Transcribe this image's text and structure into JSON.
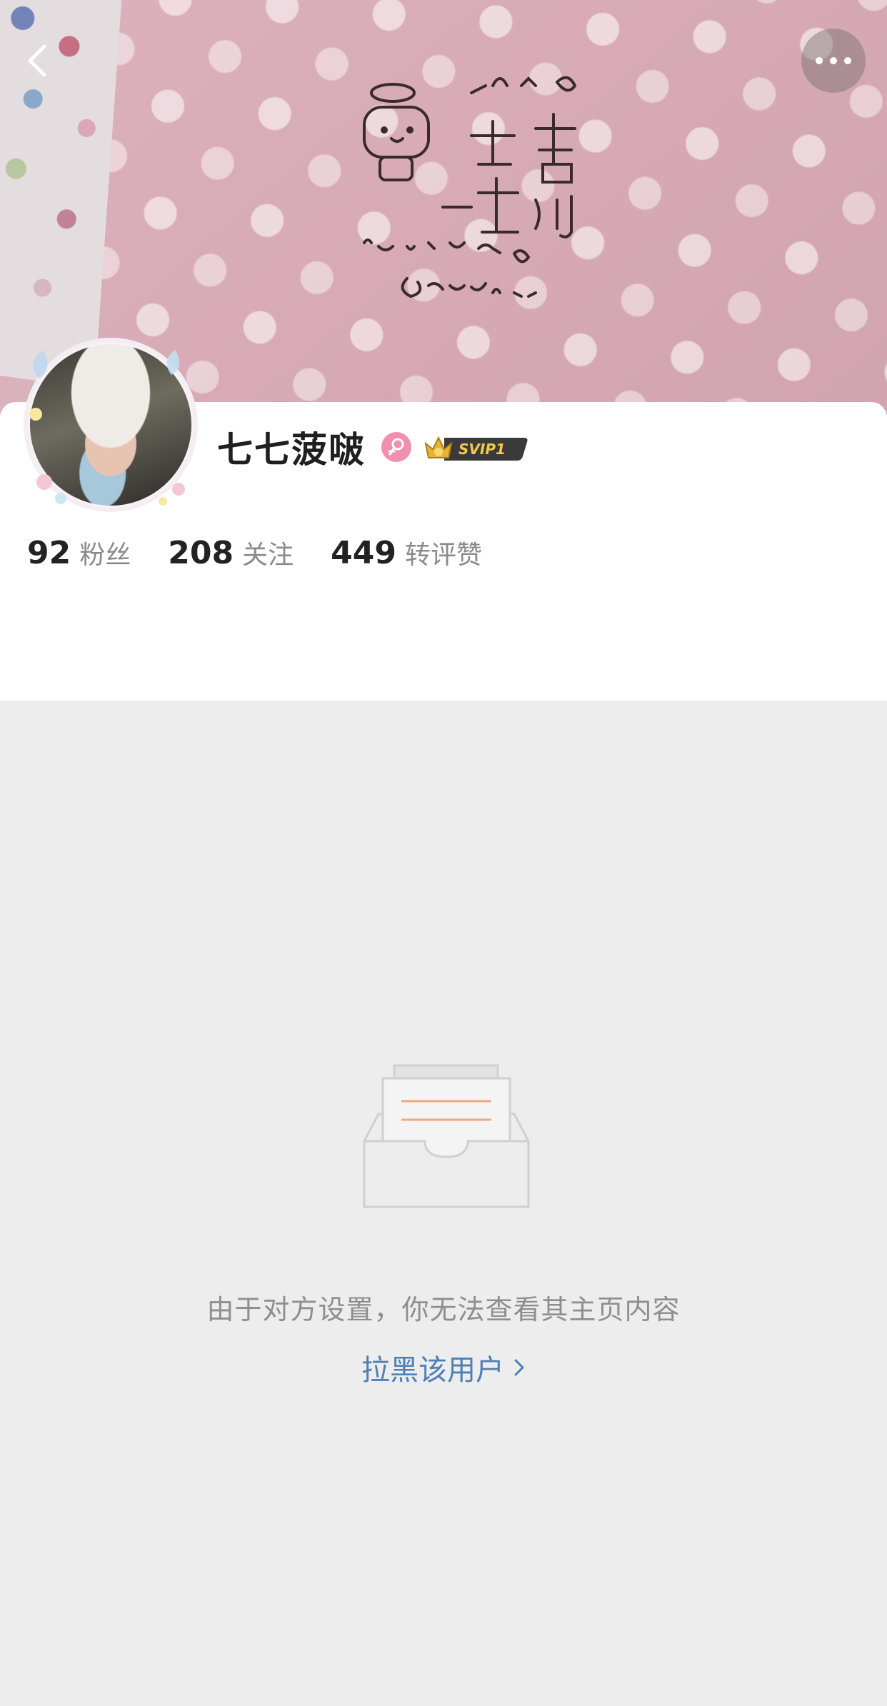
{
  "header": {
    "back_icon": "chevron-left-icon",
    "more_icon": "more-dots-icon"
  },
  "profile": {
    "name": "七七菠啵",
    "gender_icon": "female-icon",
    "vip_label": "SVIP1",
    "stats": [
      {
        "value": "92",
        "label": "粉丝"
      },
      {
        "value": "208",
        "label": "关注"
      },
      {
        "value": "449",
        "label": "转评赞"
      }
    ]
  },
  "empty_state": {
    "icon": "empty-box-icon",
    "message": "由于对方设置，你无法查看其主页内容",
    "block_link": "拉黑该用户"
  },
  "colors": {
    "link": "#4f7fb3",
    "background": "#ededed",
    "gender_badge": "#f28fb1",
    "vip_gold": "#e4b33a"
  }
}
